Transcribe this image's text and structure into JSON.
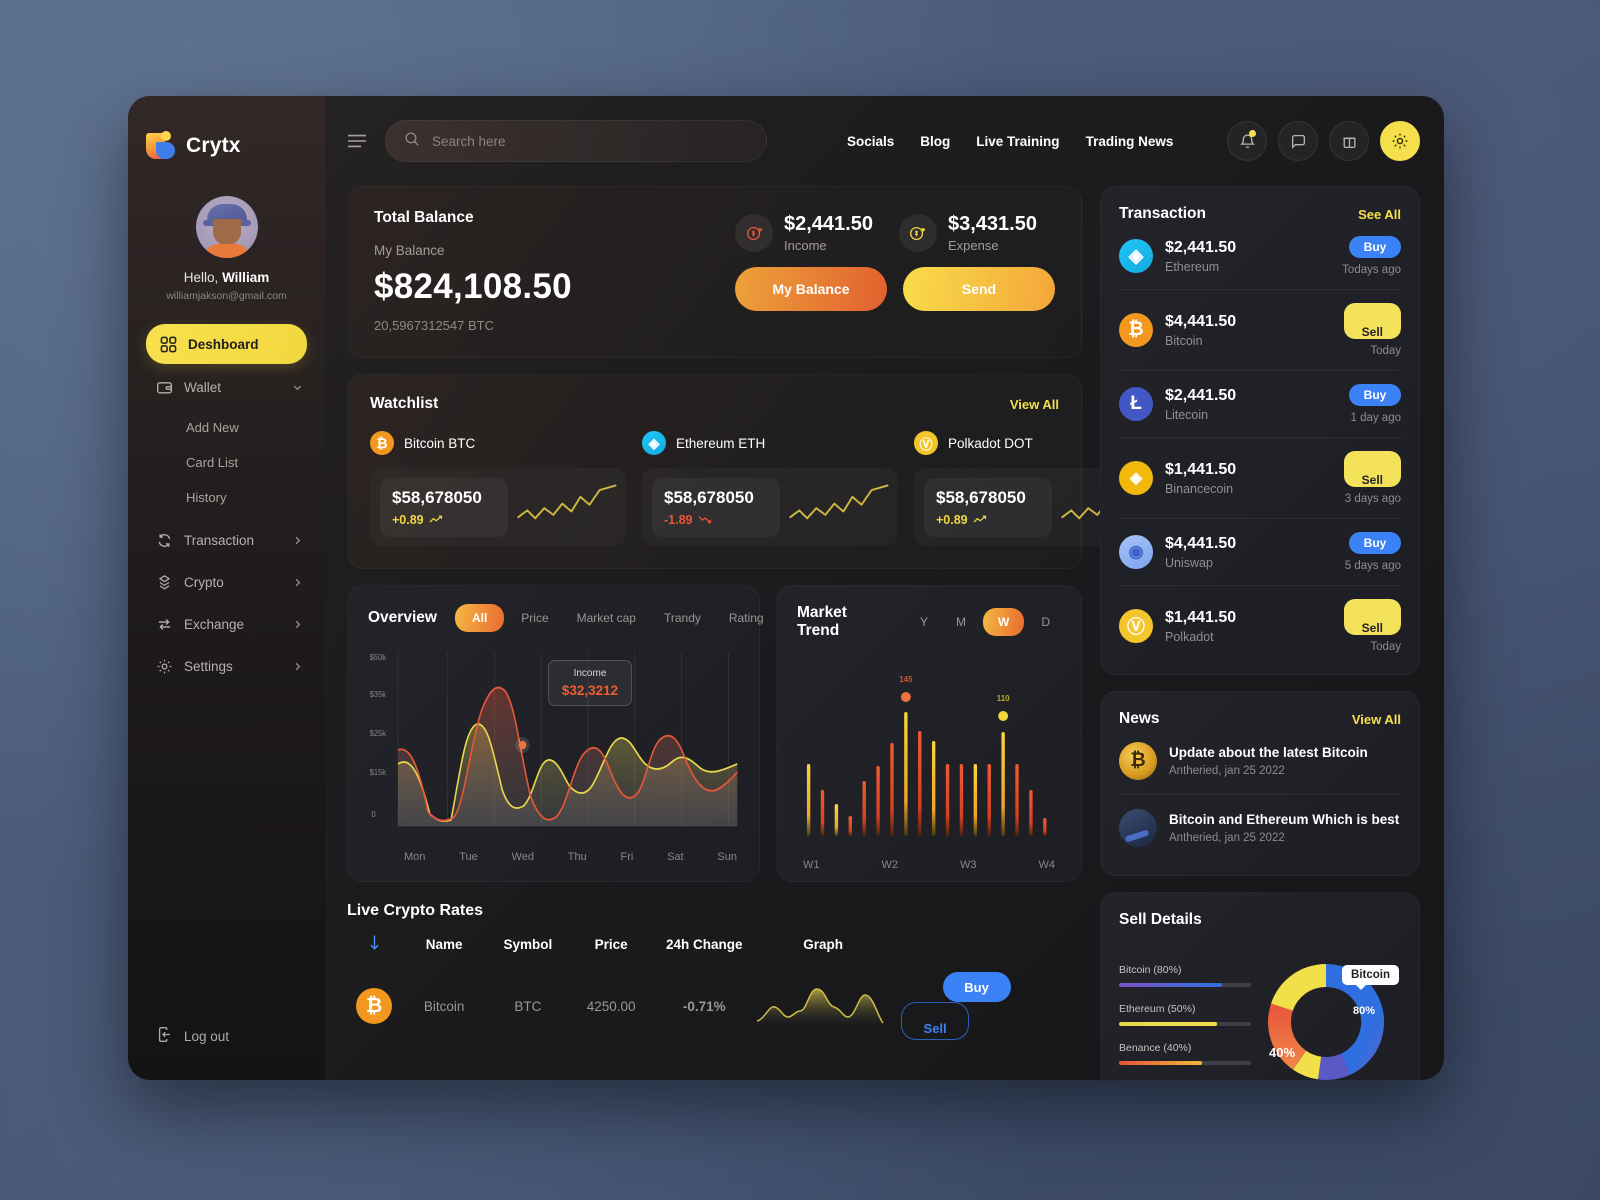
{
  "brand": {
    "name": "Crytx"
  },
  "search": {
    "placeholder": "Search here",
    "value": ""
  },
  "topnav": [
    {
      "label": "Socials"
    },
    {
      "label": "Blog"
    },
    {
      "label": "Live Training"
    },
    {
      "label": "Trading News"
    }
  ],
  "top_icons": [
    {
      "name": "bell-icon",
      "label": "Notifications"
    },
    {
      "name": "chat-icon",
      "label": "Messages"
    },
    {
      "name": "gift-icon",
      "label": "Rewards"
    },
    {
      "name": "gear-icon",
      "label": "Settings"
    }
  ],
  "profile": {
    "greeting_prefix": "Hello, ",
    "name": "William",
    "email": "williamjakson@gmail.com"
  },
  "sidebar": {
    "items": [
      {
        "label": "Deshboard",
        "icon": "grid-icon",
        "active": true
      },
      {
        "label": "Wallet",
        "icon": "wallet-icon",
        "chevron": "down"
      },
      {
        "label": "Add New",
        "sub": true
      },
      {
        "label": "Card List",
        "sub": true
      },
      {
        "label": "History",
        "sub": true
      },
      {
        "label": "Transaction",
        "icon": "refresh-icon",
        "chevron": "right"
      },
      {
        "label": "Crypto",
        "icon": "coins-icon",
        "chevron": "right"
      },
      {
        "label": "Exchange",
        "icon": "exchange-icon",
        "chevron": "right"
      },
      {
        "label": "Settings",
        "icon": "gear-icon",
        "chevron": "right"
      }
    ],
    "logout_label": "Log out"
  },
  "balance": {
    "title": "Total Balance",
    "subtitle": "My Balance",
    "amount": "$824,108.50",
    "btc": "20,5967312547 BTC",
    "income": {
      "value": "$2,441.50",
      "label": "Income"
    },
    "expense": {
      "value": "$3,431.50",
      "label": "Expense"
    },
    "btn_balance": "My Balance",
    "btn_send": "Send"
  },
  "watchlist": {
    "title": "Watchlist",
    "view_all": "View All",
    "items": [
      {
        "name": "Bitcoin BTC",
        "symbol": "B",
        "price": "$58,678050",
        "change": "+0.89",
        "dir": "up"
      },
      {
        "name": "Ethereum ETH",
        "symbol": "E",
        "price": "$58,678050",
        "change": "-1.89",
        "dir": "down"
      },
      {
        "name": "Polkadot DOT",
        "symbol": "P",
        "price": "$58,678050",
        "change": "+0.89",
        "dir": "up"
      }
    ]
  },
  "overview": {
    "title": "Overview",
    "tabs": [
      "All",
      "Price",
      "Market cap",
      "Trandy",
      "Rating"
    ],
    "active_tab": "All",
    "tooltip": {
      "label": "Income",
      "value": "$32,3212"
    }
  },
  "market_trend": {
    "title": "Market Trend",
    "tabs": [
      "Y",
      "M",
      "W",
      "D"
    ],
    "active_tab": "W",
    "marker_high": "145",
    "marker_mid": "110"
  },
  "rates": {
    "title": "Live Crypto Rates",
    "columns": [
      "",
      "Name",
      "Symbol",
      "Price",
      "24h Change",
      "Graph",
      ""
    ],
    "rows": [
      {
        "name": "Bitcoin",
        "symbol": "BTC",
        "price": "4250.00",
        "change": "-0.71%",
        "buy": "Buy",
        "sell": "Sell"
      }
    ]
  },
  "transaction": {
    "title": "Transaction",
    "see_all": "See All",
    "rows": [
      {
        "amount": "$2,441.50",
        "name": "Ethereum",
        "tag": "Buy",
        "time": "Todays ago",
        "coin": "eth",
        "glyph": "♦"
      },
      {
        "amount": "$4,441.50",
        "name": "Bitcoin",
        "tag": "Sell",
        "time": "Today",
        "coin": "btc",
        "glyph": "₿"
      },
      {
        "amount": "$2,441.50",
        "name": "Litecoin",
        "tag": "Buy",
        "time": "1 day ago",
        "coin": "ltc",
        "glyph": "Ł"
      },
      {
        "amount": "$1,441.50",
        "name": "Binancecoin",
        "tag": "Sell",
        "time": "3 days ago",
        "coin": "bnb",
        "glyph": "◈"
      },
      {
        "amount": "$4,441.50",
        "name": "Uniswap",
        "tag": "Buy",
        "time": "5 days ago",
        "coin": "uni",
        "glyph": "ᵤ"
      },
      {
        "amount": "$1,441.50",
        "name": "Polkadot",
        "tag": "Sell",
        "time": "Today",
        "coin": "dot",
        "glyph": "Ⓟ"
      }
    ]
  },
  "news": {
    "title": "News",
    "view_all": "View All",
    "rows": [
      {
        "title": "Update about the latest Bitcoin",
        "meta": "Antheried, jan 25 2022"
      },
      {
        "title": "Bitcoin and Ethereum Which is best",
        "meta": "Antheried, jan 25 2022"
      }
    ]
  },
  "sell_details": {
    "title": "Sell Details",
    "legend": [
      {
        "label": "Bitcoin (80%)",
        "pct": 80,
        "color": "#2f6fe0"
      },
      {
        "label": "Ethereum (50%)",
        "pct": 50,
        "color": "#f2e04a"
      },
      {
        "label": "Benance (40%)",
        "pct": 40,
        "color": "#e8533a"
      }
    ],
    "tooltip": "Bitcoin",
    "label_80": "80%",
    "label_40": "40%"
  },
  "chart_data": [
    {
      "type": "area",
      "title": "Overview",
      "xlabel": "",
      "ylabel": "",
      "categories": [
        "Mon",
        "Tue",
        "Wed",
        "Thu",
        "Fri",
        "Sat",
        "Sun"
      ],
      "ytick_labels": [
        "0",
        "$15k",
        "$25k",
        "$35k",
        "$50k"
      ],
      "ytick_values": [
        0,
        15000,
        25000,
        35000,
        50000
      ],
      "ylim": [
        0,
        50000
      ],
      "grid": true,
      "legend": "none",
      "annotation": {
        "label": "Income",
        "value": "$32,3212",
        "at_x": "Thu"
      },
      "series": [
        {
          "name": "Income",
          "color": "#e8563a",
          "values": [
            21000,
            16000,
            2000,
            30000,
            45000,
            5000,
            14000,
            30000,
            8000,
            16000
          ]
        },
        {
          "name": "Expense",
          "color": "#e8d84a",
          "values": [
            18000,
            13000,
            2000,
            34000,
            14000,
            7000,
            20000,
            13000,
            25000,
            17000
          ]
        }
      ]
    },
    {
      "type": "bar",
      "title": "Market Trend",
      "xlabel": "",
      "ylabel": "",
      "categories": [
        "W1",
        "W2",
        "W3",
        "W4"
      ],
      "tick_labels": [
        "W1",
        "W2",
        "W3",
        "W4"
      ],
      "grid": false,
      "bar_values": [
        72,
        46,
        32,
        20,
        55,
        70,
        93,
        145,
        105,
        100,
        92,
        72,
        72,
        72,
        110,
        72,
        48,
        18
      ],
      "bar_colors": [
        "#f2c23a",
        "#e8563a",
        "#f2c23a",
        "#e8563a",
        "#e8563a",
        "#e8563a",
        "#e8563a",
        "#f2b83a",
        "#e8563a",
        "#f2c23a",
        "#e8563a",
        "#e8563a",
        "#f2c23a",
        "#e8563a",
        "#f2c23a",
        "#e8563a",
        "#e8563a",
        "#e8563a"
      ],
      "markers": [
        {
          "index": 7,
          "label": "145",
          "color": "#f0743a"
        },
        {
          "index": 14,
          "label": "110",
          "color": "#f2d83a"
        }
      ]
    },
    {
      "type": "pie",
      "title": "Sell Details",
      "labels": [
        "Bitcoin",
        "Ethereum",
        "Benance"
      ],
      "values": [
        80,
        50,
        40
      ],
      "colors": [
        "#2f6fe0",
        "#f2e04a",
        "#e8533a"
      ],
      "donut": true,
      "annotations": [
        {
          "label": "Bitcoin",
          "value": "80%"
        },
        {
          "label": "",
          "value": "40%"
        }
      ]
    },
    {
      "type": "line",
      "title": "Bitcoin sparkline",
      "values": [
        8,
        22,
        10,
        16,
        8,
        38,
        30,
        12,
        34,
        10,
        6
      ],
      "color": "#c9bb45"
    }
  ]
}
